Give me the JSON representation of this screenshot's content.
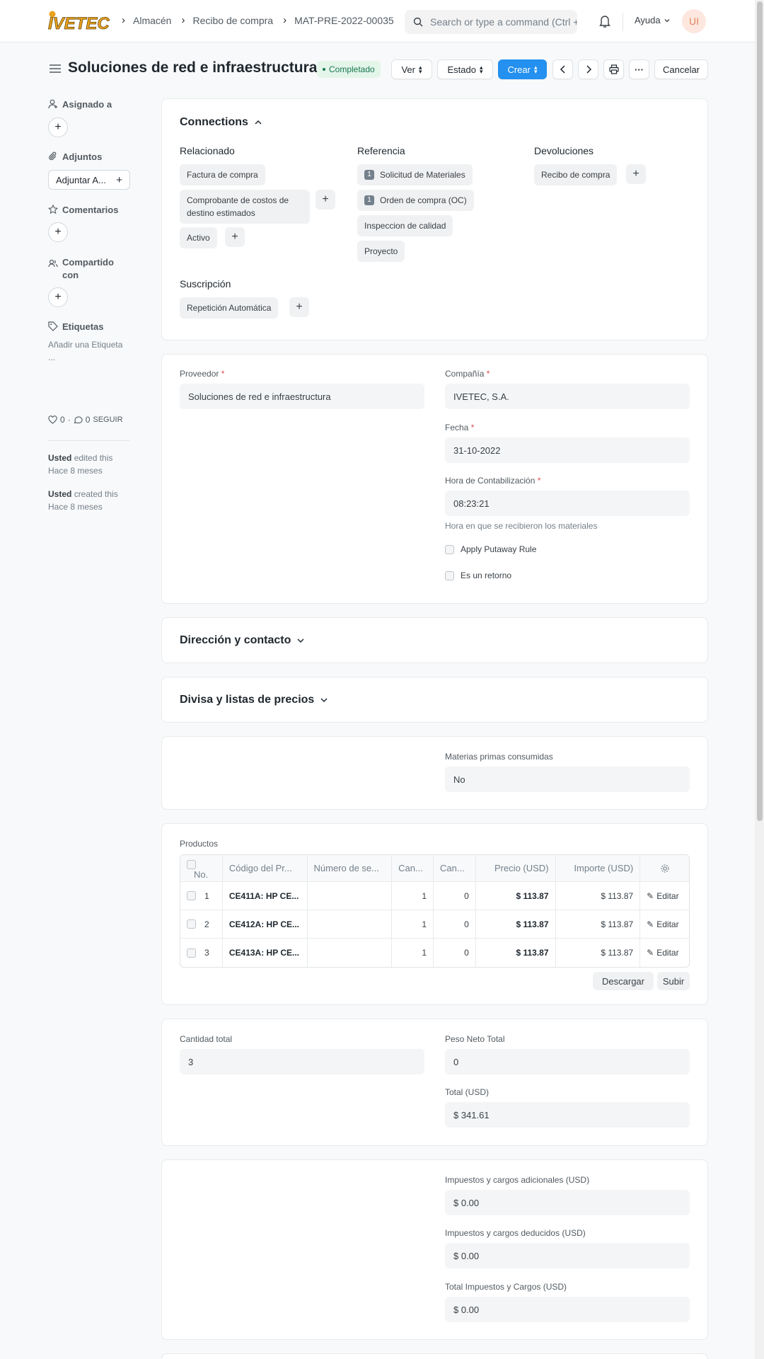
{
  "navbar": {
    "logo_text": "IVETEC",
    "breadcrumbs": [
      "Almacén",
      "Recibo de compra",
      "MAT-PRE-2022-00035"
    ],
    "search_placeholder": "Search or type a command (Ctrl + G)",
    "help_label": "Ayuda",
    "avatar_initials": "UI"
  },
  "page": {
    "title": "Soluciones de red e infraestructura",
    "status": "Completado",
    "buttons": {
      "view": "Ver",
      "status": "Estado",
      "create": "Crear",
      "more": "···",
      "cancel": "Cancelar"
    }
  },
  "sidebar": {
    "assigned": "Asignado a",
    "attachments": "Adjuntos",
    "attach_button": "Adjuntar A...",
    "comments": "Comentarios",
    "shared": "Compartido con",
    "tags": "Etiquetas",
    "add_tag": "Añadir una Etiqueta",
    "ellipsis": "...",
    "likes": "0",
    "comment_count": "0",
    "follow": "SEGUIR",
    "activity": [
      {
        "user": "Usted",
        "action": "edited this",
        "when": "Hace 8 meses"
      },
      {
        "user": "Usted",
        "action": "created this",
        "when": "Hace 8 meses"
      }
    ]
  },
  "connections": {
    "title": "Connections",
    "related": {
      "title": "Relacionado",
      "items": [
        "Factura de compra",
        "Comprobante de costos de destino estimados",
        "Activo"
      ]
    },
    "reference": {
      "title": "Referencia",
      "items": [
        {
          "label": "Solicitud de Materiales",
          "count": "1"
        },
        {
          "label": "Orden de compra (OC)",
          "count": "1"
        },
        {
          "label": "Inspeccion de calidad"
        },
        {
          "label": "Proyecto"
        }
      ]
    },
    "returns": {
      "title": "Devoluciones",
      "items": [
        "Recibo de compra"
      ]
    },
    "subscription": {
      "title": "Suscripción",
      "items": [
        "Repetición Automática"
      ]
    }
  },
  "details": {
    "supplier_label": "Proveedor",
    "supplier": "Soluciones de red e infraestructura",
    "company_label": "Compañía",
    "company": "IVETEC, S.A.",
    "date_label": "Fecha",
    "date": "31-10-2022",
    "time_label": "Hora de Contabilización",
    "time": "08:23:21",
    "time_hint": "Hora en que se recibieron los materiales",
    "putaway": "Apply Putaway Rule",
    "is_return": "Es un retorno"
  },
  "sections": {
    "address": "Dirección y contacto",
    "currency": "Divisa y listas de precios"
  },
  "raw_materials": {
    "label": "Materias primas consumidas",
    "value": "No"
  },
  "products": {
    "label": "Productos",
    "columns": [
      "No.",
      "Código del Pr...",
      "Número de se...",
      "Can...",
      "Can...",
      "Precio (USD)",
      "Importe (USD)"
    ],
    "rows": [
      {
        "no": "1",
        "code": "CE411A: HP CE...",
        "serial": "",
        "qty": "1",
        "qty2": "0",
        "rate": "$ 113.87",
        "amount": "$ 113.87"
      },
      {
        "no": "2",
        "code": "CE412A: HP CE...",
        "serial": "",
        "qty": "1",
        "qty2": "0",
        "rate": "$ 113.87",
        "amount": "$ 113.87"
      },
      {
        "no": "3",
        "code": "CE413A: HP CE...",
        "serial": "",
        "qty": "1",
        "qty2": "0",
        "rate": "$ 113.87",
        "amount": "$ 113.87"
      }
    ],
    "edit_label": "Editar",
    "download": "Descargar",
    "upload": "Subir"
  },
  "totals": {
    "qty_label": "Cantidad total",
    "qty": "3",
    "net_weight_label": "Peso Neto Total",
    "net_weight": "0",
    "total_label": "Total (USD)",
    "total": "$ 341.61"
  },
  "taxes": {
    "added_label": "Impuestos y cargos adicionales (USD)",
    "added": "$ 0.00",
    "deducted_label": "Impuestos y cargos deducidos (USD)",
    "deducted": "$ 0.00",
    "total_label": "Total Impuestos y Cargos (USD)",
    "total": "$ 0.00"
  },
  "colors": {
    "primary": "#2490ef",
    "success": "#16794c",
    "logo": "#e8a21e"
  }
}
